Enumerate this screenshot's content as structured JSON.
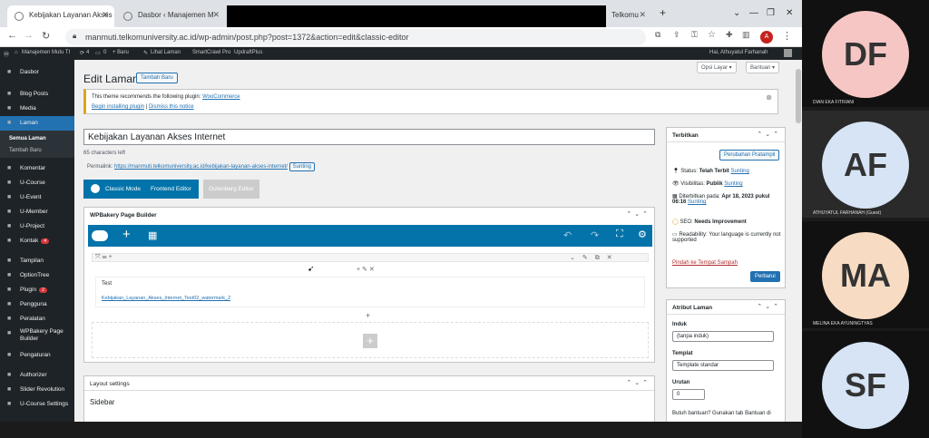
{
  "browser": {
    "tabs": [
      "Kebijakan Layanan Akses I",
      "Dasbor ‹ Manajemen M",
      "Telkomu"
    ],
    "url": "manmuti.telkomuniversity.ac.id/wp-admin/post.php?post=1372&action=edit&classic-editor",
    "new_tab": "+",
    "avatar_letter": "A"
  },
  "adminbar": {
    "site": "Manajemen Mutu TI",
    "updates": "4",
    "comments": "0",
    "new": "+ Baru",
    "view": "Lihat Laman",
    "smartcrawl": "SmartCrawl Pro",
    "updraft": "UpdraftPlus",
    "howdy": "Hai, Athuyatul Farhanah"
  },
  "sidebar": {
    "items": [
      {
        "label": "Dasbor",
        "icon": "gauge-icon"
      },
      {
        "label": "Blog Posts",
        "icon": "pin-icon"
      },
      {
        "label": "Media",
        "icon": "media-icon"
      },
      {
        "label": "Laman",
        "icon": "page-icon"
      },
      {
        "label": "Komentar",
        "icon": "comment-icon"
      },
      {
        "label": "U-Course",
        "icon": "pin-icon"
      },
      {
        "label": "U-Event",
        "icon": "pin-icon"
      },
      {
        "label": "U-Member",
        "icon": "pin-icon"
      },
      {
        "label": "U-Project",
        "icon": "pin-icon"
      },
      {
        "label": "Kontak",
        "icon": "mail-icon",
        "badge": "4"
      },
      {
        "label": "Tampilan",
        "icon": "brush-icon"
      },
      {
        "label": "OptionTree",
        "icon": "tree-icon"
      },
      {
        "label": "Plugin",
        "icon": "plug-icon",
        "badge": "2"
      },
      {
        "label": "Pengguna",
        "icon": "user-icon"
      },
      {
        "label": "Peralatan",
        "icon": "wrench-icon"
      },
      {
        "label": "WPBakery Page Builder",
        "icon": "cloud-icon"
      },
      {
        "label": "Pengaturan",
        "icon": "settings-icon"
      },
      {
        "label": "Authorizer",
        "icon": "lock-icon"
      },
      {
        "label": "Slider Revolution",
        "icon": "refresh-icon"
      },
      {
        "label": "U-Course Settings",
        "icon": "gear-icon"
      }
    ],
    "subitems": [
      "Semua Laman",
      "Tambah Baru"
    ]
  },
  "header": {
    "screen_options": "Opsi Layar ▾",
    "help": "Bantuan ▾",
    "title": "Edit Laman",
    "add_new": "Tambah Baru"
  },
  "notice": {
    "text": "This theme recommends the following plugin: ",
    "plugin": "WooCommerce",
    "begin": "Begin installing plugin",
    "sep": " | ",
    "dismiss": "Dismiss this notice"
  },
  "editor": {
    "post_title": "Kebijakan Layanan Akses Internet",
    "char_count": "65 characters left",
    "permalink_label": "Permalink: ",
    "permalink": "https://manmuti.telkomuniversity.ac.id/kebijakan-layanan-akses-internet/",
    "permalink_edit": "Sunting",
    "classic": "Classic Mode",
    "frontend": "Frontend Editor",
    "gutenberg": "Gutenberg Editor"
  },
  "wpb": {
    "title": "WPBakery Page Builder",
    "text_title": "Test",
    "text_link": "Kebijakan_Layanan_Akses_Internet_Test02_watermark_2"
  },
  "layout": {
    "title": "Layout settings",
    "sidebar_label": "Sidebar"
  },
  "publish": {
    "title": "Terbitkan",
    "preview": "Perubahan Pratampil",
    "status_label": "Status:",
    "status": "Telah Terbit",
    "visibility_label": "Visibilitas:",
    "visibility": "Publik",
    "published_label": "Diterbitkan pada:",
    "published": "Apr 18, 2023 pukul 06:16",
    "edit": "Sunting",
    "seo_label": "SEO:",
    "seo": "Needs Improvement",
    "readability_label": "Readability:",
    "readability": "Your language is currently not supported",
    "trash": "Pindah ke Tempat Sampah",
    "update": "Perbarui"
  },
  "attributes": {
    "title": "Atribut Laman",
    "parent_label": "Induk",
    "parent_value": "(tanpa induk)",
    "template_label": "Templat",
    "template_value": "Template standar",
    "order_label": "Urutan",
    "order_value": "0",
    "help_text": "Butuh bantuan? Gunakan tab Bantuan di"
  },
  "participants": [
    {
      "initials": "DF",
      "name": "DIAN EKA FITRIANI",
      "color": "#f5c6c4"
    },
    {
      "initials": "AF",
      "name": "ATHUYATUL FARHANAH (Guest)",
      "color": "#d6e4f5"
    },
    {
      "initials": "MA",
      "name": "MELINA EKA AYUNINGTYAS",
      "color": "#f7dcc3"
    },
    {
      "initials": "SF",
      "name": "",
      "color": "#d6e4f5"
    }
  ]
}
